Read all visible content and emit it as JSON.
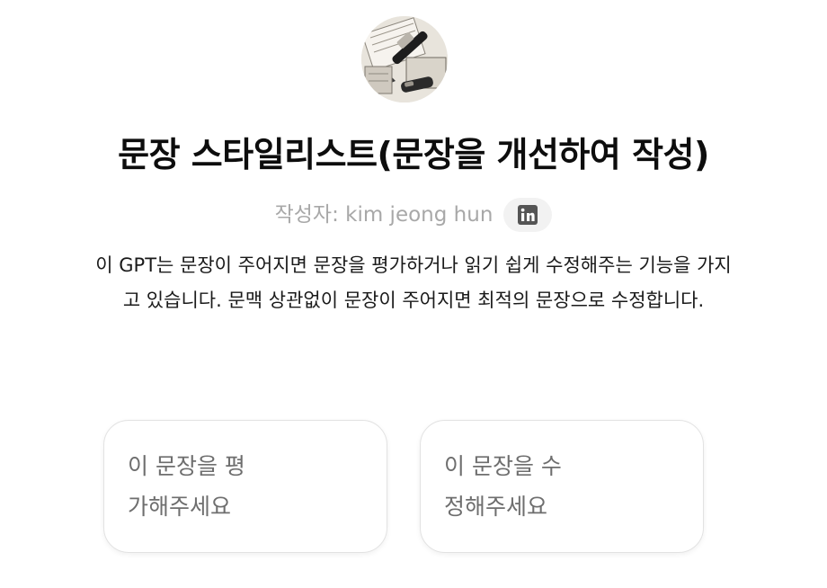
{
  "gpt": {
    "avatar_icon": "fountain-pen-image",
    "title": "문장 스타일리스트(문장을 개선하여 작성)",
    "author": "작성자: kim jeong hun",
    "author_link_icon": "linkedin-icon",
    "description_lines": [
      "이 GPT는 문장이 주어지면 문장을 평가하거나 읽기 쉽게 수정해주는 기능을 가지",
      "고 있습니다. 문맥 상관없이 문장이 주어지면 최적의 문장으로 수정합니다."
    ]
  },
  "starters": [
    {
      "lines": [
        "이 문장을 평",
        "가해주세요"
      ]
    },
    {
      "lines": [
        "이 문장을 수",
        "정해주세요"
      ]
    }
  ],
  "colors": {
    "title": "#0d0d0d",
    "muted": "#a8a8a8",
    "card_border": "#e2e2e2",
    "card_text": "#6e6e6e",
    "linkedin": "#555555"
  }
}
